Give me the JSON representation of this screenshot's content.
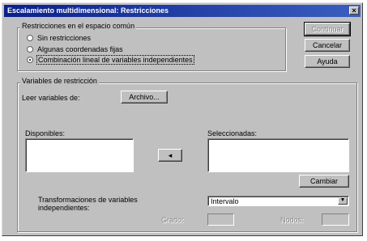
{
  "window": {
    "title": "Escalamiento multidimensional: Restricciones",
    "close_glyph": "×"
  },
  "buttons": {
    "continue": "Continuar",
    "cancel": "Cancelar",
    "help": "Ayuda",
    "file": "Archivo...",
    "move": "◂",
    "change": "Cambiar"
  },
  "common_space": {
    "label": "Restricciones en el espacio común",
    "options": [
      {
        "label": "Sin restricciones",
        "selected": false
      },
      {
        "label": "Algunas coordenadas fijas",
        "selected": false
      },
      {
        "label": "Combinación lineal de variables independientes",
        "selected": true
      }
    ]
  },
  "restriction_vars": {
    "label": "Variables de restricción",
    "read_label": "Leer variables de:",
    "available_label": "Disponibles:",
    "selected_label": "Seleccionadas:",
    "transform_label": "Transformaciones de variables independientes:",
    "transform_value": "Intervalo",
    "degree_label": "Grado:",
    "knots_label": "Nodos:"
  }
}
